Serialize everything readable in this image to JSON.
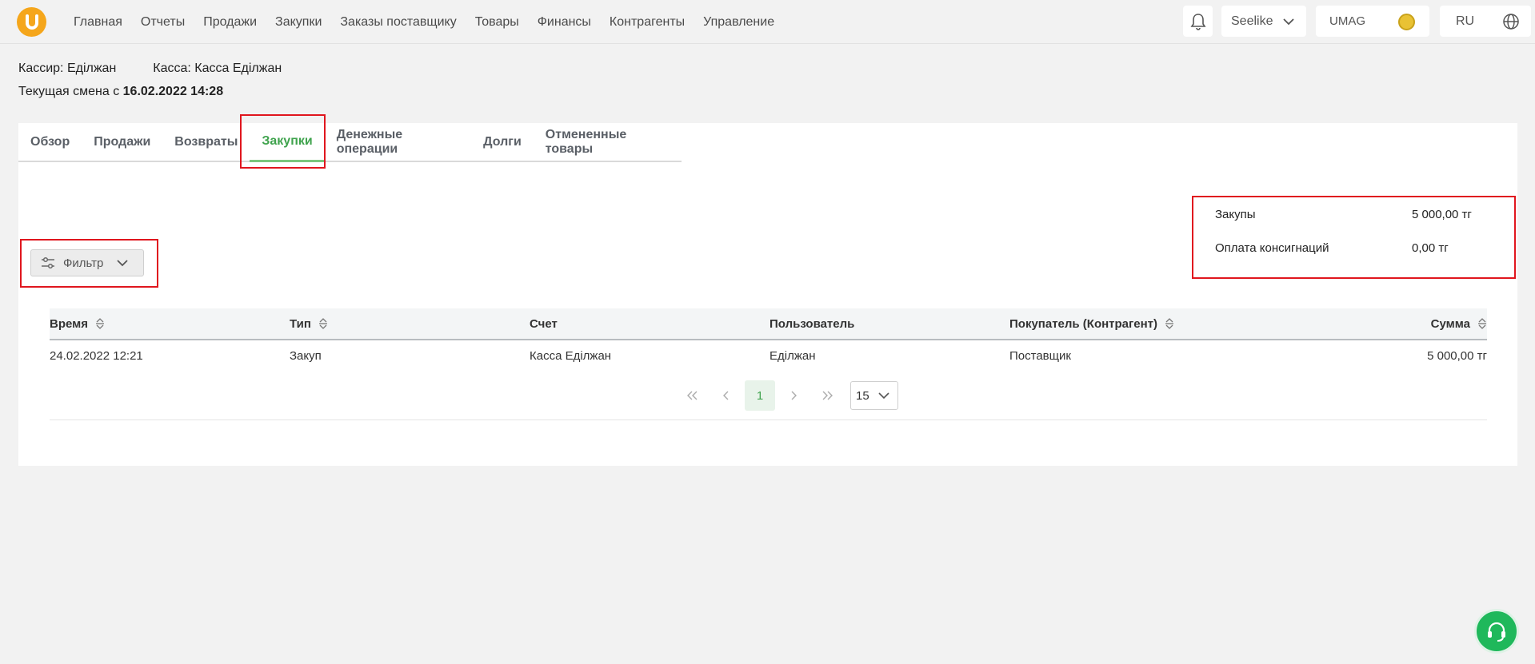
{
  "nav": {
    "items": [
      "Главная",
      "Отчеты",
      "Продажи",
      "Закупки",
      "Заказы поставщику",
      "Товары",
      "Финансы",
      "Контрагенты",
      "Управление"
    ]
  },
  "header": {
    "user": "Seelike",
    "store": "UMAG",
    "lang": "RU"
  },
  "shift": {
    "cashier": "Кассир: Еділжан",
    "register": "Касса: Касса Еділжан",
    "current_label": "Текущая смена с ",
    "current_value": "16.02.2022 14:28"
  },
  "tabs": [
    {
      "label": "Обзор",
      "active": false
    },
    {
      "label": "Продажи",
      "active": false
    },
    {
      "label": "Возвраты",
      "active": false
    },
    {
      "label": "Закупки",
      "active": true
    },
    {
      "label": "Денежные операции",
      "active": false
    },
    {
      "label": "Долги",
      "active": false
    },
    {
      "label": "Отмененные товары",
      "active": false
    }
  ],
  "summary": {
    "purchases_label": "Закупы",
    "purchases_value": "5 000,00 тг",
    "consignment_label": "Оплата консигнаций",
    "consignment_value": "0,00 тг"
  },
  "filter": {
    "label": "Фильтр"
  },
  "table": {
    "headers": {
      "time": "Время",
      "type": "Тип",
      "account": "Счет",
      "user": "Пользователь",
      "buyer": "Покупатель (Контрагент)",
      "sum": "Сумма"
    },
    "rows": [
      {
        "time": "24.02.2022 12:21",
        "type": "Закуп",
        "account": "Касса Еділжан",
        "user": "Еділжан",
        "buyer": "Поставщик",
        "sum": "5 000,00 тг"
      }
    ]
  },
  "pagination": {
    "current": "1",
    "page_size": "15"
  },
  "colors": {
    "accent": "#3fa34d",
    "highlight": "#e0161e",
    "logo": "#f5a61b",
    "support": "#1fb85b"
  }
}
